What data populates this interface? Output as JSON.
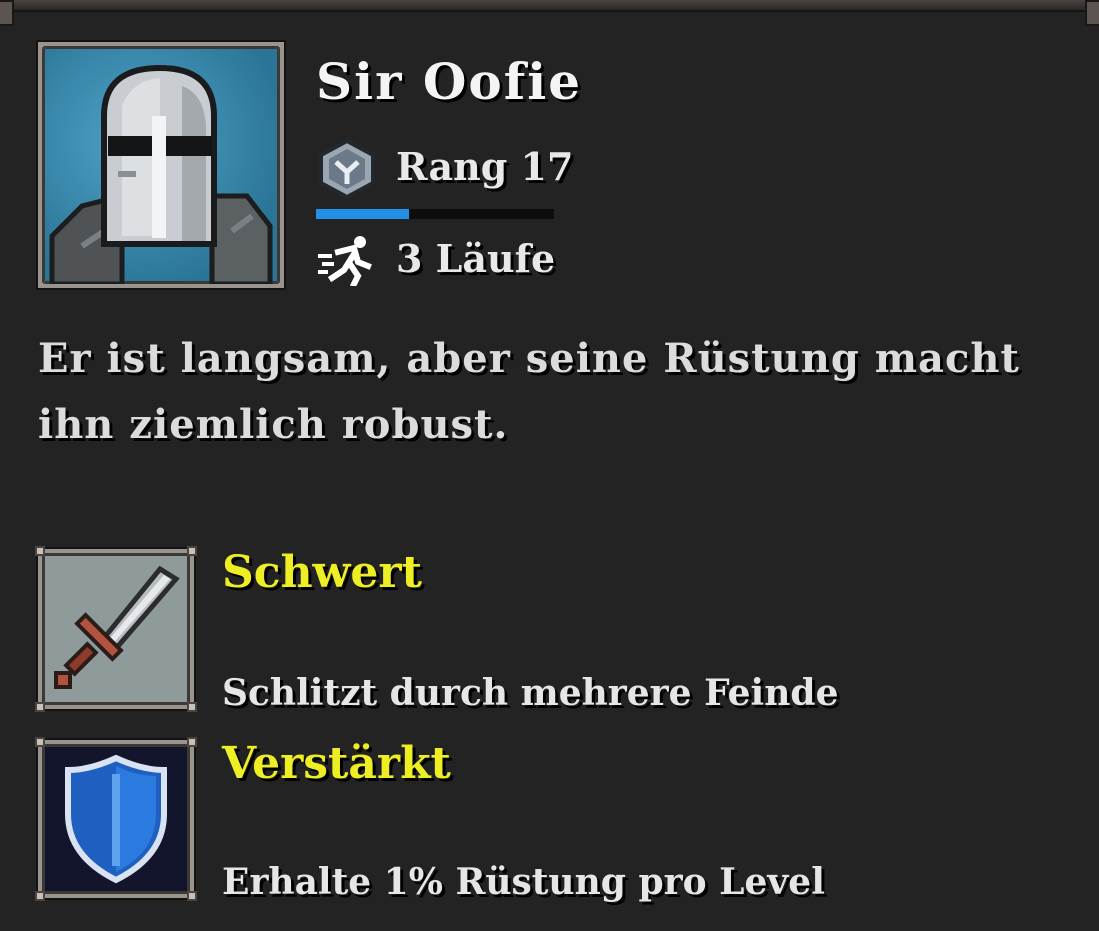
{
  "character": {
    "name": "Sir Oofie",
    "rank_label": "Rang 17",
    "rank_progress_fraction": 0.39,
    "runs_label": "3 Läufe",
    "description": "Er ist langsam, aber seine Rüstung macht ihn ziemlich robust.",
    "portrait_icon": "knight-helmet-icon"
  },
  "abilities": [
    {
      "name": "Schwert",
      "description": "Schlitzt durch mehrere Feinde",
      "icon": "sword-icon"
    },
    {
      "name": "Verstärkt",
      "description": "Erhalte 1% Rüstung pro Level",
      "icon": "shield-icon"
    }
  ],
  "colors": {
    "background": "#232323",
    "ability_name": "#eeee24",
    "xp_bar": "#2390e6",
    "portrait_bg": "#2f81a6"
  }
}
